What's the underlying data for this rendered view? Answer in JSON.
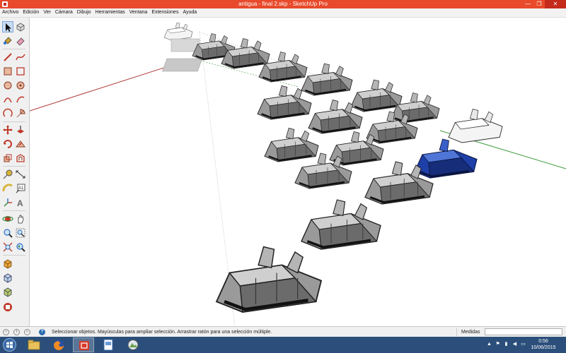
{
  "window": {
    "title": "antigua - final 2.skp - SketchUp Pro",
    "controls": {
      "minimize": "—",
      "restore": "❐",
      "close": "✕"
    }
  },
  "menu": [
    "Archivo",
    "Edición",
    "Ver",
    "Cámara",
    "Dibujo",
    "Herramientas",
    "Ventana",
    "Extensiones",
    "Ayuda"
  ],
  "toolbar": {
    "tools": [
      {
        "name": "select-tool-icon",
        "active": true
      },
      {
        "name": "make-component-icon"
      },
      {
        "name": "paint-bucket-icon"
      },
      {
        "name": "eraser-icon"
      },
      {
        "name": "line-icon"
      },
      {
        "name": "freehand-icon"
      },
      {
        "name": "rectangle-icon"
      },
      {
        "name": "rotated-rectangle-icon"
      },
      {
        "name": "circle-icon"
      },
      {
        "name": "polygon-icon"
      },
      {
        "name": "arc-icon"
      },
      {
        "name": "two-point-arc-icon"
      },
      {
        "name": "three-point-arc-icon"
      },
      {
        "name": "pie-icon"
      },
      {
        "name": "move-icon"
      },
      {
        "name": "push-pull-icon"
      },
      {
        "name": "rotate-icon"
      },
      {
        "name": "follow-me-icon"
      },
      {
        "name": "scale-icon"
      },
      {
        "name": "offset-icon"
      },
      {
        "name": "tape-measure-icon"
      },
      {
        "name": "dimension-icon"
      },
      {
        "name": "protractor-icon"
      },
      {
        "name": "text-icon"
      },
      {
        "name": "axes-icon"
      },
      {
        "name": "3d-text-icon"
      },
      {
        "name": "orbit-icon"
      },
      {
        "name": "pan-icon"
      },
      {
        "name": "zoom-icon"
      },
      {
        "name": "zoom-window-icon"
      },
      {
        "name": "zoom-extents-icon"
      },
      {
        "name": "previous-view-icon"
      },
      {
        "name": "warehouse-icon"
      },
      {
        "name": "share-model-icon"
      },
      {
        "name": "extension-warehouse-icon"
      },
      {
        "name": "layout-icon"
      }
    ]
  },
  "status": {
    "text": "Seleccionar objetos. Mayúsculas para ampliar selección. Arrastrar ratón para una selección múltiple.",
    "measurements_label": "Medidas",
    "measurements_value": ""
  },
  "taskbar": {
    "apps": [
      "file-explorer-icon",
      "firefox-icon",
      "sketchup-icon",
      "document-viewer-icon",
      "image-viewer-icon"
    ],
    "tray": [
      "up-arrow",
      "flag",
      "network",
      "volume",
      "keyboard"
    ],
    "time": "0:56",
    "date": "10/06/2015"
  },
  "colors": {
    "titlebar": "#e84a2b",
    "close": "#c42b1c",
    "taskbar": "#2b4f7a",
    "ship_gray": "#8a8a8a",
    "ship_blue": "#1f3fa8",
    "axis_red": "#b03a3a",
    "axis_green": "#3a9a3a"
  }
}
